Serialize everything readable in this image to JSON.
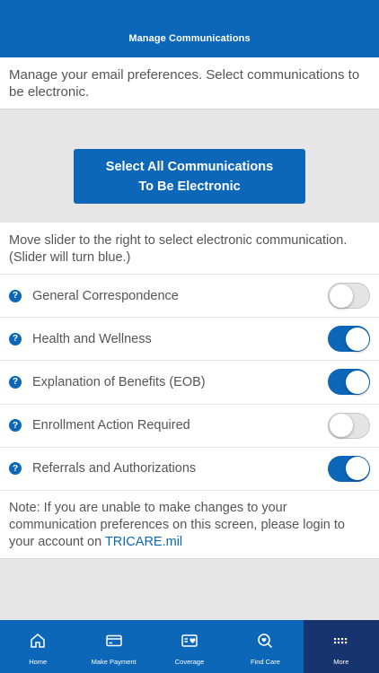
{
  "header": {
    "title": "Manage Communications"
  },
  "intro": {
    "text": "Manage your email preferences. Select communications to be electronic."
  },
  "select_all": {
    "line1": "Select All Communications",
    "line2": "To Be Electronic"
  },
  "instructions": {
    "text": "Move slider to the right to select electronic communication. (Slider will turn blue.)"
  },
  "preferences": [
    {
      "label": "General Correspondence",
      "enabled": false
    },
    {
      "label": "Health and Wellness",
      "enabled": true
    },
    {
      "label": "Explanation of Benefits (EOB)",
      "enabled": true
    },
    {
      "label": "Enrollment Action Required",
      "enabled": false
    },
    {
      "label": "Referrals and Authorizations",
      "enabled": true
    }
  ],
  "help_icon_glyph": "?",
  "note": {
    "text": "Note: If you are unable to make changes to your communication preferences on this screen, please login to your account on ",
    "link": "TRICARE.mil"
  },
  "tabs": [
    {
      "label": "Home",
      "icon": "home-icon"
    },
    {
      "label": "Make Payment",
      "icon": "credit-card-icon"
    },
    {
      "label": "Coverage",
      "icon": "coverage-card-icon"
    },
    {
      "label": "Find Care",
      "icon": "find-care-search-icon"
    },
    {
      "label": "More",
      "icon": "grid-dots-icon",
      "active": true
    }
  ],
  "colors": {
    "primary": "#0d67b8",
    "active_tab": "#17346e",
    "background": "#e6e6e6",
    "text": "#555555"
  }
}
